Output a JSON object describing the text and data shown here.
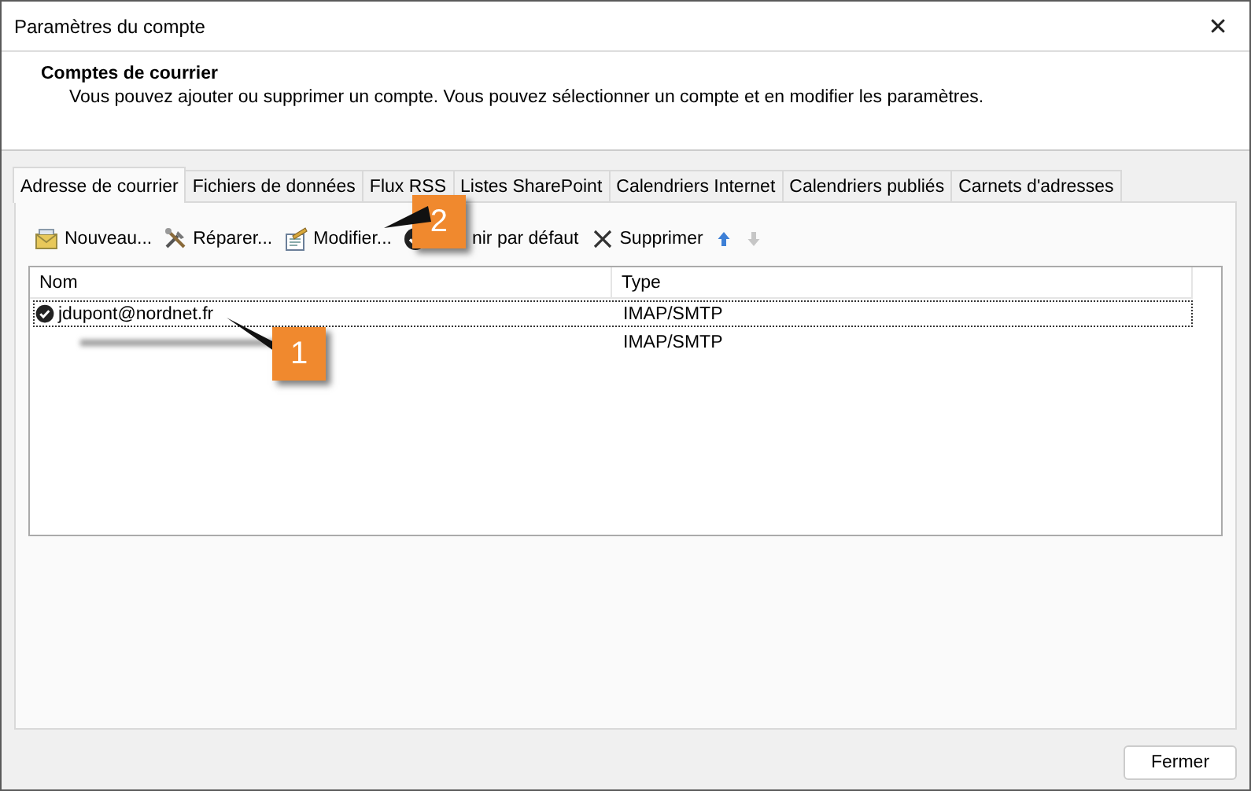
{
  "window": {
    "title": "Paramètres du compte",
    "close": "✕"
  },
  "header": {
    "title": "Comptes de courrier",
    "description": "Vous pouvez ajouter ou supprimer un compte. Vous pouvez sélectionner un compte et en modifier les paramètres."
  },
  "tabs": [
    {
      "label": "Adresse de courrier",
      "selected": true
    },
    {
      "label": "Fichiers de données",
      "selected": false
    },
    {
      "label": "Flux RSS",
      "selected": false
    },
    {
      "label": "Listes SharePoint",
      "selected": false
    },
    {
      "label": "Calendriers Internet",
      "selected": false
    },
    {
      "label": "Calendriers publiés",
      "selected": false
    },
    {
      "label": "Carnets d'adresses",
      "selected": false
    }
  ],
  "toolbar": [
    {
      "kind": "new",
      "label": "Nouveau...",
      "disabled": false
    },
    {
      "kind": "repair",
      "label": "Réparer...",
      "disabled": false
    },
    {
      "kind": "modify",
      "label": "Modifier...",
      "disabled": false
    },
    {
      "kind": "default",
      "label": "nir par défaut",
      "disabled": false
    },
    {
      "kind": "delete",
      "label": "Supprimer",
      "disabled": false
    },
    {
      "kind": "up",
      "disabled": false
    },
    {
      "kind": "down",
      "disabled": true
    }
  ],
  "table": {
    "columns": [
      "Nom",
      "Type"
    ],
    "rows": [
      {
        "name": "jdupont@nordnet.fr",
        "type": "IMAP/SMTP",
        "selected": true,
        "default": true,
        "redacted": false
      },
      {
        "type": "IMAP/SMTP",
        "selected": false,
        "default": false,
        "redacted": true
      }
    ]
  },
  "callouts": [
    {
      "number": "1"
    },
    {
      "number": "2"
    }
  ],
  "buttons": [
    "Fermer"
  ]
}
